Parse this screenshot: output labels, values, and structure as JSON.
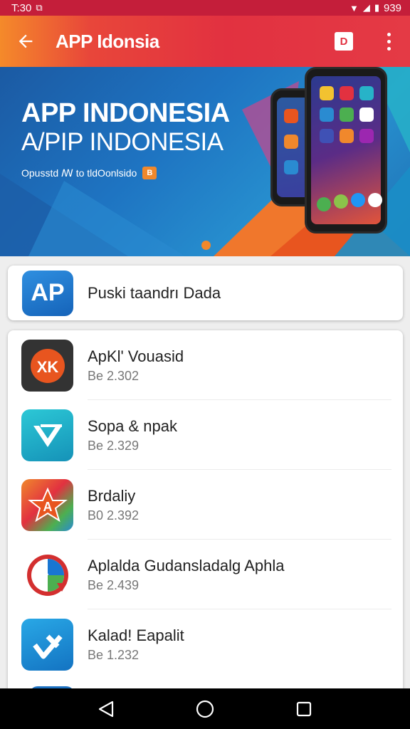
{
  "status_bar": {
    "time": "T:30",
    "right_text": "939"
  },
  "app_bar": {
    "title": "APP Idonsia",
    "square_button_label": "D"
  },
  "banner": {
    "title_line_1": "APP INDONESIA",
    "title_line_2": "A/PIP INDONESIA",
    "subtitle": "Opusstd ꟿ to tldOonlsido",
    "badge": "B"
  },
  "featured": {
    "icon_text": "AP",
    "label": "Puski taandrı Dada"
  },
  "apps": [
    {
      "title": "ApKl' Vouasid",
      "subtitle": "Be 2.302",
      "icon_text": "XK",
      "icon_bg": "#3a3a3a"
    },
    {
      "title": "Sopa & npak",
      "subtitle": "Be 2.329",
      "icon_text": "V",
      "icon_bg": "#19b0c6"
    },
    {
      "title": "Brdaliy",
      "subtitle": "B0 2.392",
      "icon_text": "A",
      "icon_bg": "#e8551f"
    },
    {
      "title": "Aplalda Gudansladalg Aphla",
      "subtitle": "Be 2.439",
      "icon_text": "",
      "icon_bg": "#ffffff"
    },
    {
      "title": "Kalad! Eapalit",
      "subtitle": "Be 1.232",
      "icon_text": "V",
      "icon_bg": "#1a8fd8"
    }
  ],
  "colors": {
    "accent": "#e23140",
    "banner_blue": "#1e74c2",
    "orange": "#f0882c"
  }
}
